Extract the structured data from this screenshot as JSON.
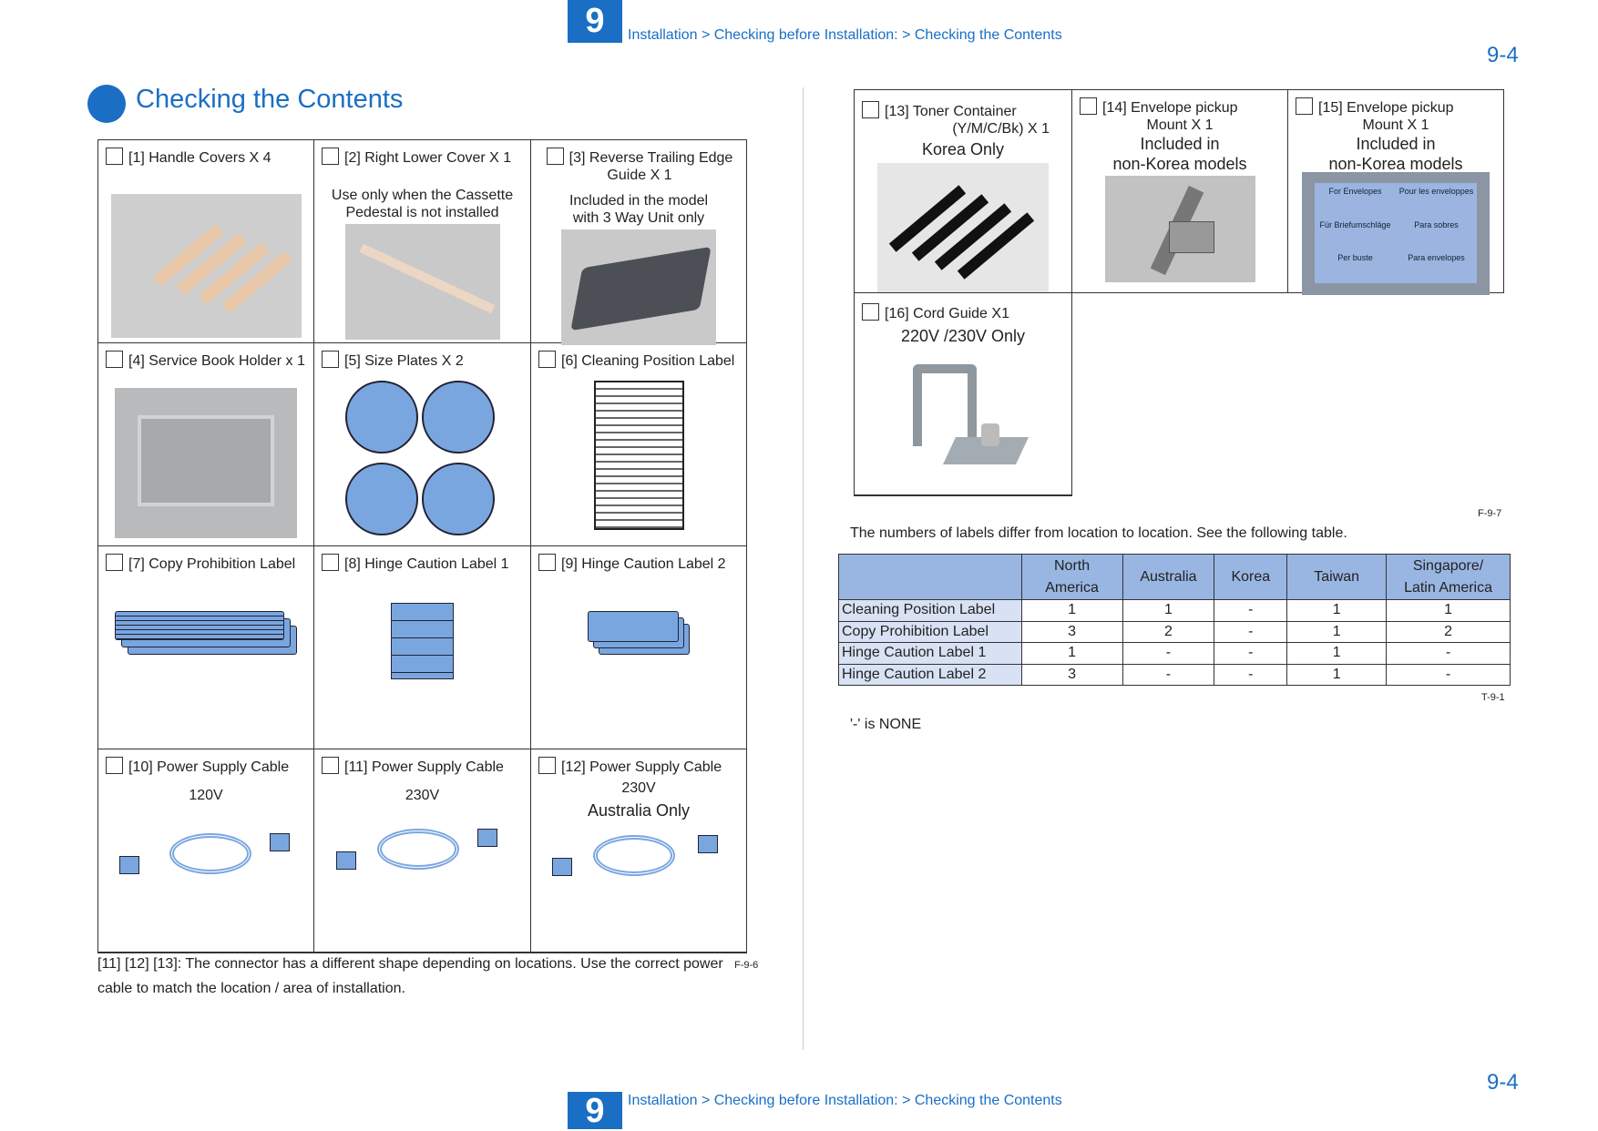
{
  "header": {
    "chapter": "9",
    "breadcrumb": "Installation > Checking before Installation: > Checking the Contents",
    "page": "9-4"
  },
  "footer": {
    "chapter": "9",
    "breadcrumb": "Installation > Checking before Installation: > Checking the Contents",
    "page": "9-4"
  },
  "title": "Checking the Contents",
  "left_items": [
    {
      "label": "[1] Handle Covers X 4",
      "sub": ""
    },
    {
      "label": "[2] Right Lower Cover X 1",
      "sub": "Use only when the Cassette Pedestal is not installed"
    },
    {
      "label": "[3] Reverse Trailing Edge Guide X 1",
      "sub": "Included in the model with 3 Way Unit only"
    },
    {
      "label": "[4] Service Book Holder x 1",
      "sub": ""
    },
    {
      "label": "[5] Size Plates X 2",
      "sub": ""
    },
    {
      "label": "[6] Cleaning Position Label",
      "sub": ""
    },
    {
      "label": "[7] Copy Prohibition Label",
      "sub": ""
    },
    {
      "label": "[8] Hinge Caution Label 1",
      "sub": ""
    },
    {
      "label": "[9] Hinge Caution Label 2",
      "sub": ""
    },
    {
      "label": "[10] Power Supply Cable",
      "sub": "120V"
    },
    {
      "label": "[11] Power Supply Cable",
      "sub": "230V"
    },
    {
      "label": "[12] Power Supply Cable",
      "sub": "230V",
      "sub2": "Australia Only"
    }
  ],
  "left_note": "[11] [12] [13]: The connector has a different shape depending on locations. Use the correct power cable to match the location / area of installation.",
  "left_fig": "F-9-6",
  "right_items": [
    {
      "label": "[13] Toner Container",
      "label2": "(Y/M/C/Bk) X 1",
      "sub": "Korea Only"
    },
    {
      "label": "[14] Envelope pickup",
      "label2": "Mount  X 1",
      "sub": "Included in",
      "sub2": "non-Korea models"
    },
    {
      "label": "[15] Envelope pickup",
      "label2": "Mount  X 1",
      "sub": "Included in",
      "sub2": "non-Korea models"
    },
    {
      "label": "[16] Cord Guide X1",
      "sub": "220V /230V Only"
    }
  ],
  "envelope_label_text": [
    "For Envelopes",
    "Pour les enveloppes",
    "Für Briefumschläge",
    "Para sobres",
    "Per buste",
    "Para envelopes"
  ],
  "right_fig": "F-9-7",
  "table_intro": "The numbers of labels differ from location to location. See the following table.",
  "table": {
    "headers": [
      "",
      "North America",
      "Australia",
      "Korea",
      "Taiwan",
      "Singapore/ Latin America"
    ],
    "rows": [
      [
        "Cleaning Position Label",
        "1",
        "1",
        "-",
        "1",
        "1"
      ],
      [
        "Copy Prohibition Label",
        "3",
        "2",
        "-",
        "1",
        "2"
      ],
      [
        "Hinge Caution Label 1",
        "1",
        "-",
        "-",
        "1",
        "-"
      ],
      [
        "Hinge Caution Label 2",
        "3",
        "-",
        "-",
        "1",
        "-"
      ]
    ]
  },
  "table_id": "T-9-1",
  "table_note": "'-' is NONE",
  "colors": {
    "accent": "#1a6fc4",
    "table_header": "#99b6e2",
    "row_header": "#d8e2f4",
    "label_blue": "#7aa6e0"
  }
}
